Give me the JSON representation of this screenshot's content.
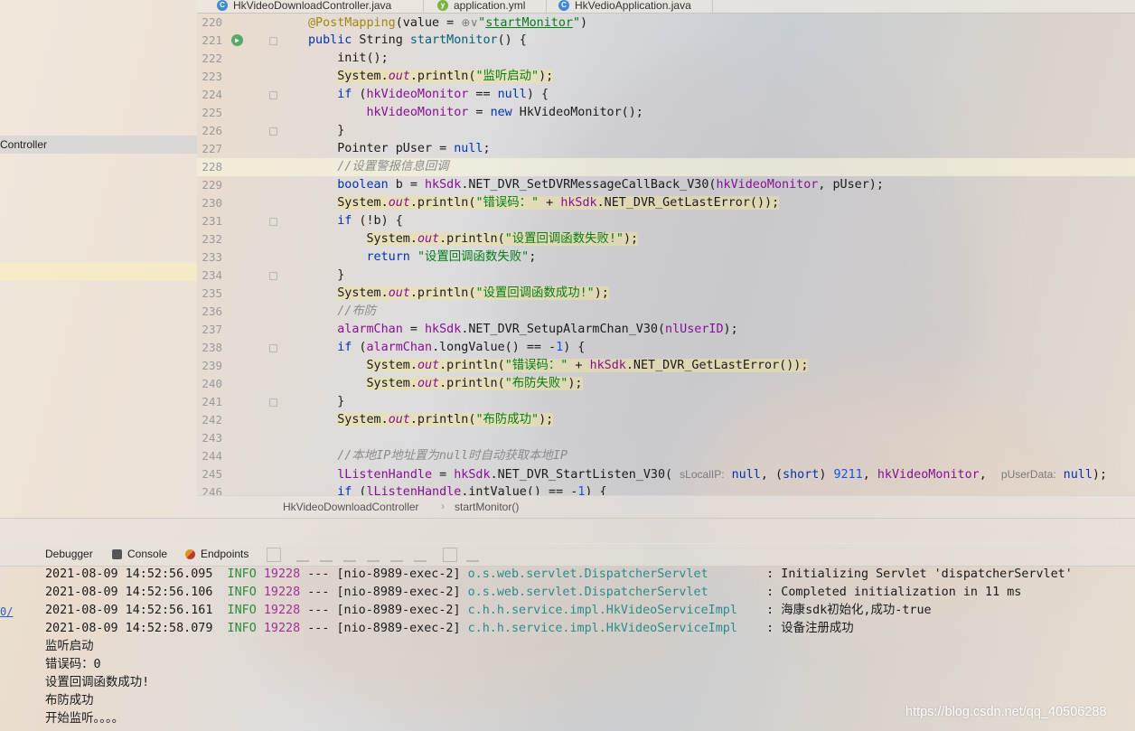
{
  "tabs": [
    {
      "label": "HkVideoDownloadController.java",
      "icon": "class-icon"
    },
    {
      "label": "application.yml",
      "icon": "yaml-icon"
    },
    {
      "label": "HkVedioApplication.java",
      "icon": "class-icon"
    }
  ],
  "project_tree": {
    "selected_item": "Controller"
  },
  "editor": {
    "lines": [
      {
        "num": "220",
        "html": "<span class='ann'>@PostMapping</span>(value = <span class='hint'>⊕∨</span><span class='str'>\"<u>startMonitor</u>\"</span>)",
        "fold": false
      },
      {
        "num": "221",
        "html": "<span class='kw'>public</span> String <span style='color:#00627a'>startMonitor</span>() {",
        "fold": true,
        "run": true
      },
      {
        "num": "222",
        "html": "    init();",
        "fold": false
      },
      {
        "num": "223",
        "html": "    <span class='sysbg'>System.<span class='stat'>out</span>.println(<span class='str'>\"监听启动\"</span>);</span>",
        "fold": false
      },
      {
        "num": "224",
        "html": "    <span class='kw'>if</span> (<span class='fld'>hkVideoMonitor</span> == <span class='kw'>null</span>) {",
        "fold": true
      },
      {
        "num": "225",
        "html": "        <span class='fld'>hkVideoMonitor</span> = <span class='kw'>new</span> HkVideoMonitor();",
        "fold": false
      },
      {
        "num": "226",
        "html": "    }",
        "fold": true
      },
      {
        "num": "227",
        "html": "    Pointer pUser = <span class='kw'>null</span>;",
        "fold": false
      },
      {
        "num": "228",
        "html": "    <span class='cm'>//设置警报信息回调</span>",
        "fold": false,
        "hl": true
      },
      {
        "num": "229",
        "html": "    <span class='kw'>boolean</span> b = <span class='fld'>hkSdk</span>.NET_DVR_SetDVRMessageCallBack_V30(<span class='fld'>hkVideoMonitor</span>, pUser);",
        "fold": false
      },
      {
        "num": "230",
        "html": "    <span class='sysbg'>System.<span class='stat'>out</span>.println(<span class='str'>\"错误码：\"</span> + <span class='fld'>hkSdk</span>.NET_DVR_GetLastError());</span>",
        "fold": false
      },
      {
        "num": "231",
        "html": "    <span class='kw'>if</span> (!b) {",
        "fold": true
      },
      {
        "num": "232",
        "html": "        <span class='sysbg'>System.<span class='stat'>out</span>.println(<span class='str'>\"设置回调函数失败!\"</span>);</span>",
        "fold": false
      },
      {
        "num": "233",
        "html": "        <span class='kw'>return</span> <span class='str'>\"设置回调函数失败\"</span>;",
        "fold": false
      },
      {
        "num": "234",
        "html": "    }",
        "fold": true
      },
      {
        "num": "235",
        "html": "    <span class='sysbg'>System.<span class='stat'>out</span>.println(<span class='str'>\"设置回调函数成功!\"</span>);</span>",
        "fold": false
      },
      {
        "num": "236",
        "html": "    <span class='cm'>//布防</span>",
        "fold": false
      },
      {
        "num": "237",
        "html": "    <span class='fld'>alarmChan</span> = <span class='fld'>hkSdk</span>.NET_DVR_SetupAlarmChan_V30(<span class='fld'>nlUserID</span>);",
        "fold": false
      },
      {
        "num": "238",
        "html": "    <span class='kw'>if</span> (<span class='fld'>alarmChan</span>.longValue() == -<span class='num'>1</span>) {",
        "fold": true
      },
      {
        "num": "239",
        "html": "        <span class='sysbg'>System.<span class='stat'>out</span>.println(<span class='str'>\"错误码：\"</span> + <span class='fld'>hkSdk</span>.NET_DVR_GetLastError());</span>",
        "fold": false
      },
      {
        "num": "240",
        "html": "        <span class='sysbg'>System.<span class='stat'>out</span>.println(<span class='str'>\"布防失败\"</span>);</span>",
        "fold": false
      },
      {
        "num": "241",
        "html": "    }",
        "fold": true
      },
      {
        "num": "242",
        "html": "    <span class='sysbg'>System.<span class='stat'>out</span>.println(<span class='str'>\"布防成功\"</span>);</span>",
        "fold": false
      },
      {
        "num": "243",
        "html": "",
        "fold": false
      },
      {
        "num": "244",
        "html": "    <span class='cm'>//本地IP地址置为null时自动获取本地IP</span>",
        "fold": false
      },
      {
        "num": "245",
        "html": "    <span class='fld'>lListenHandle</span> = <span class='fld'>hkSdk</span>.NET_DVR_StartListen_V30( <span class='hint'>sLocalIP:</span> <span class='kw'>null</span>, (<span class='kw'>short</span>) <span class='num'>9211</span>, <span class='fld'>hkVideoMonitor</span>,  <span class='hint'>pUserData:</span> <span class='kw'>null</span>);",
        "fold": false
      },
      {
        "num": "246",
        "html": "    <span class='kw'>if</span> (<span class='fld'>lListenHandle</span>.intValue() == -<span class='num'>1</span>) {",
        "fold": false
      }
    ]
  },
  "breadcrumb": {
    "class": "HkVideoDownloadController",
    "method": "startMonitor()"
  },
  "run_tabs": [
    {
      "label": "Debugger",
      "icon": "debugger-icon"
    },
    {
      "label": "Console",
      "icon": "console-icon"
    },
    {
      "label": "Endpoints",
      "icon": "endpoints-icon"
    }
  ],
  "console": {
    "log_lines": [
      {
        "ts": "2021-08-09 14:52:56.095",
        "level": "INFO",
        "pid": "19228",
        "thread": "--- [nio-8989-exec-2]",
        "logger": "o.s.web.servlet.DispatcherServlet       ",
        "msg": ": Initializing Servlet 'dispatcherServlet'"
      },
      {
        "ts": "2021-08-09 14:52:56.106",
        "level": "INFO",
        "pid": "19228",
        "thread": "--- [nio-8989-exec-2]",
        "logger": "o.s.web.servlet.DispatcherServlet       ",
        "msg": ": Completed initialization in 11 ms"
      },
      {
        "ts": "2021-08-09 14:52:56.161",
        "level": "INFO",
        "pid": "19228",
        "thread": "--- [nio-8989-exec-2]",
        "logger": "c.h.h.service.impl.HkVideoServiceImpl   ",
        "msg": ": 海康sdk初始化,成功-true"
      },
      {
        "ts": "2021-08-09 14:52:58.079",
        "level": "INFO",
        "pid": "19228",
        "thread": "--- [nio-8989-exec-2]",
        "logger": "c.h.h.service.impl.HkVideoServiceImpl   ",
        "msg": ": 设备注册成功"
      }
    ],
    "plain_lines": [
      "监听启动",
      "错误码：0",
      "设置回调函数成功!",
      "布防成功",
      "开始监听。。。。"
    ],
    "left_link": "0/"
  },
  "watermark": "https://blog.csdn.net/qq_40506288"
}
